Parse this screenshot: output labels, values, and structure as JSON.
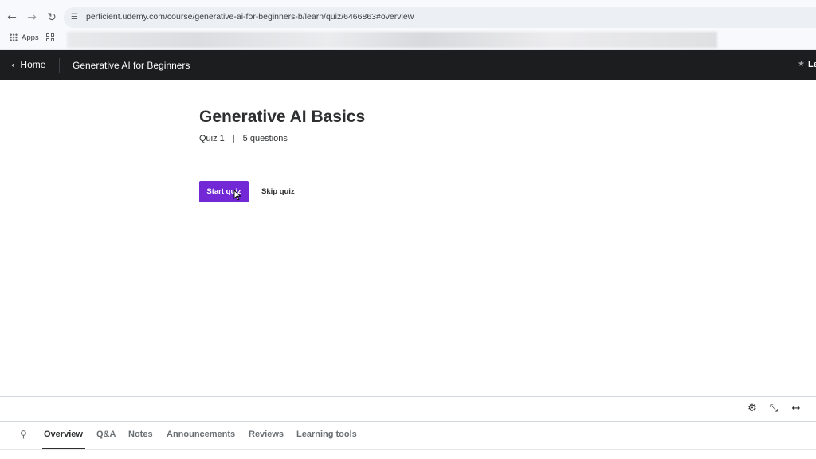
{
  "browser": {
    "back_icon": "arrow-left-icon",
    "forward_icon": "arrow-right-icon",
    "reload_icon": "reload-icon",
    "url": "perficient.udemy.com/course/generative-ai-for-beginners-b/learn/quiz/6466863#overview",
    "bookmarks": {
      "apps_label": "Apps"
    }
  },
  "header": {
    "home_label": "Home",
    "course_title": "Generative AI for Beginners",
    "right_label": "Le"
  },
  "quiz": {
    "title": "Generative AI Basics",
    "quiz_number": "Quiz 1",
    "separator": "|",
    "question_count": "5 questions",
    "start_label": "Start quiz",
    "skip_label": "Skip quiz"
  },
  "controls": {
    "icons": [
      "gear-icon",
      "expand-icon",
      "wide-view-icon"
    ]
  },
  "tabs": {
    "items": [
      {
        "label": "Overview",
        "active": true
      },
      {
        "label": "Q&A",
        "active": false
      },
      {
        "label": "Notes",
        "active": false
      },
      {
        "label": "Announcements",
        "active": false
      },
      {
        "label": "Reviews",
        "active": false
      },
      {
        "label": "Learning tools",
        "active": false
      }
    ]
  },
  "colors": {
    "header_bg": "#1c1d1f",
    "primary_button": "#7228d4",
    "text": "#2d2f31"
  }
}
